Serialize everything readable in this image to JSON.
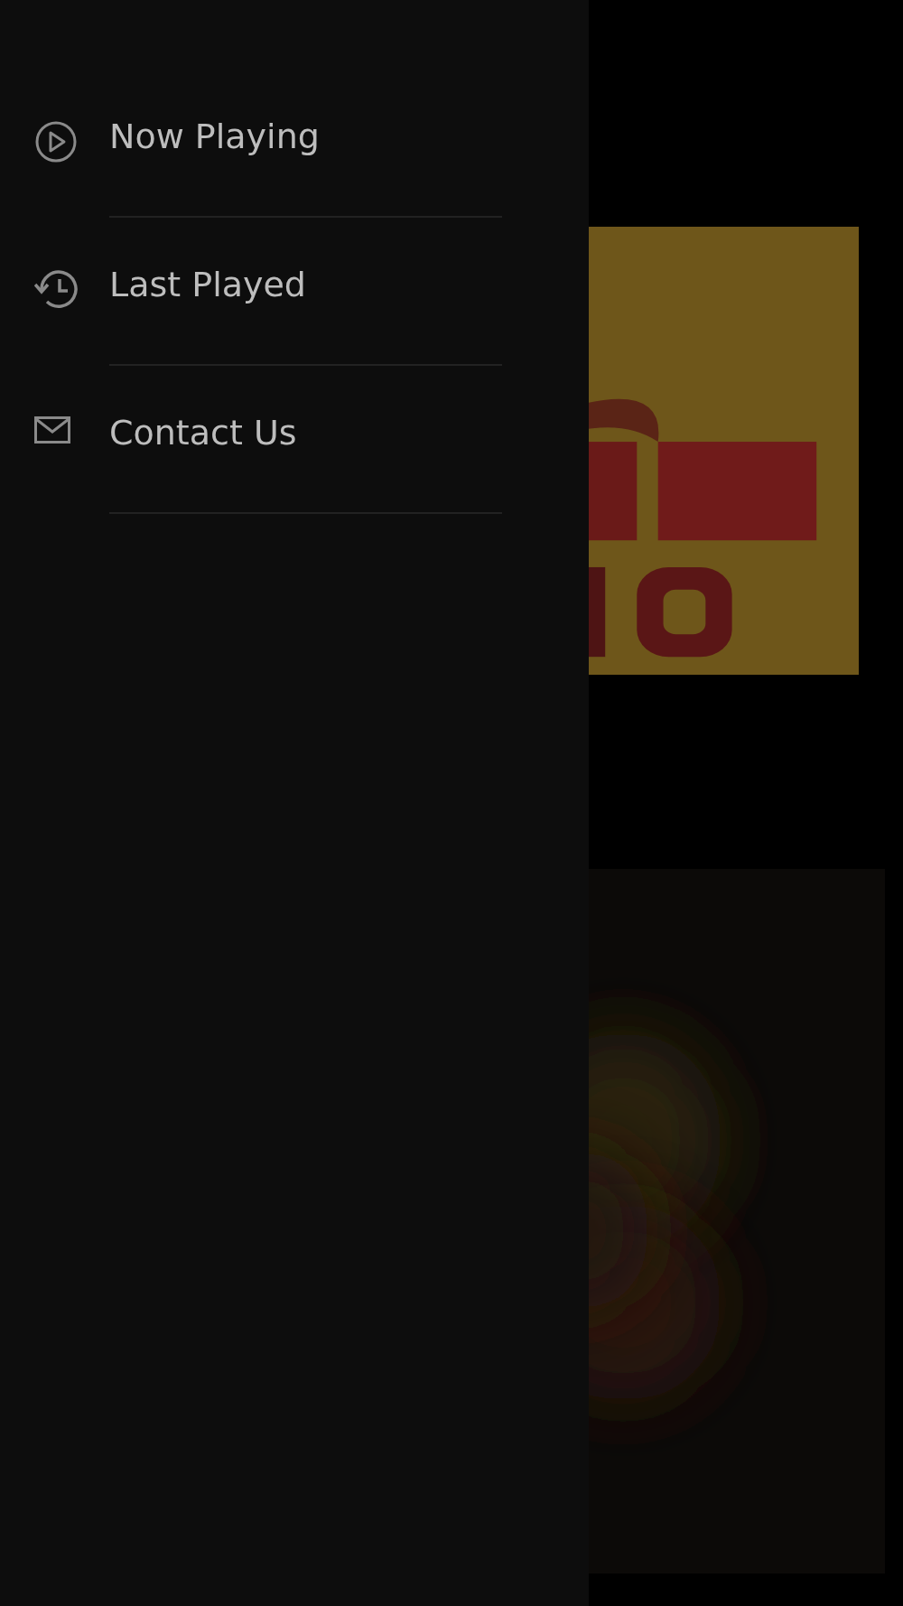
{
  "menu": {
    "items": [
      {
        "label": "Now Playing",
        "kind": "play"
      },
      {
        "label": "Last Played",
        "kind": "history"
      },
      {
        "label": "Contact Us",
        "kind": "mail"
      }
    ]
  }
}
